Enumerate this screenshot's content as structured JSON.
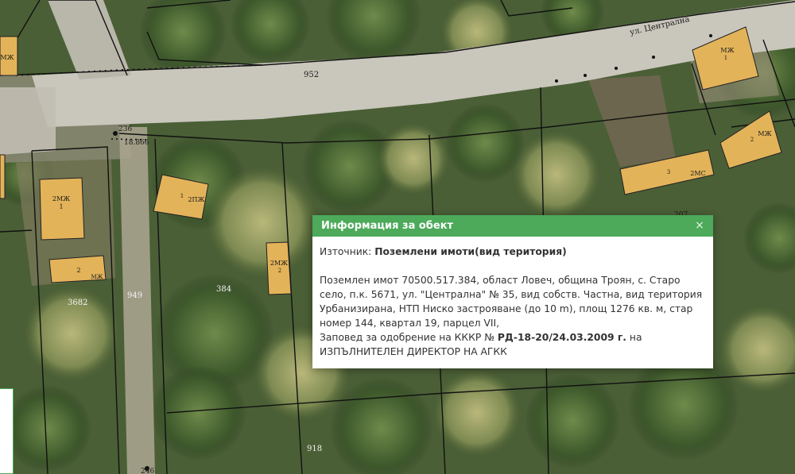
{
  "map": {
    "street_label": "ул. Централна",
    "labels": {
      "parcel_952": "952",
      "point_236": "236",
      "point_18866": "18.866",
      "parcel_384": "384",
      "parcel_949": "949",
      "parcel_3682": "3682",
      "parcel_918": "918",
      "parcel_207": "207",
      "point_246": "246"
    },
    "buildings": [
      {
        "num": "1",
        "type": "2МЖ"
      },
      {
        "num": "2",
        "type": "МЖ"
      },
      {
        "num": "1",
        "type": "2ПЖ"
      },
      {
        "num": "2",
        "type": "2МЖ"
      },
      {
        "num": "1",
        "type": "МЖ"
      },
      {
        "num": "2",
        "type": "МЖ"
      },
      {
        "num": "3",
        "type": "2МС"
      },
      {
        "num": "",
        "type": "МЖ"
      }
    ]
  },
  "popup": {
    "title": "Информация за обект",
    "close_glyph": "×",
    "source_label": "Източник:",
    "source_value": "Поземлени имоти(вид територия)",
    "description": "Поземлен имот 70500.517.384, област Ловеч, община Троян, с. Старо село, п.к. 5671, ул. \"Централна\" № 35, вид собств. Частна, вид територия Урбанизирана, НТП Ниско застрояване (до 10 m), площ 1276 кв. м, стар номер 144, квартал 19, парцел VII,",
    "order_prefix": "Заповед за одобрение на КККР №",
    "order_number": "РД-18-20/24.03.2009 г.",
    "order_suffix": "на ИЗПЪЛНИТЕЛЕН ДИРЕКТОР НА АГКК"
  },
  "colors": {
    "header_green": "#4caa5a",
    "building_fill": "#e3b35a",
    "road": "#c9c6bc"
  }
}
